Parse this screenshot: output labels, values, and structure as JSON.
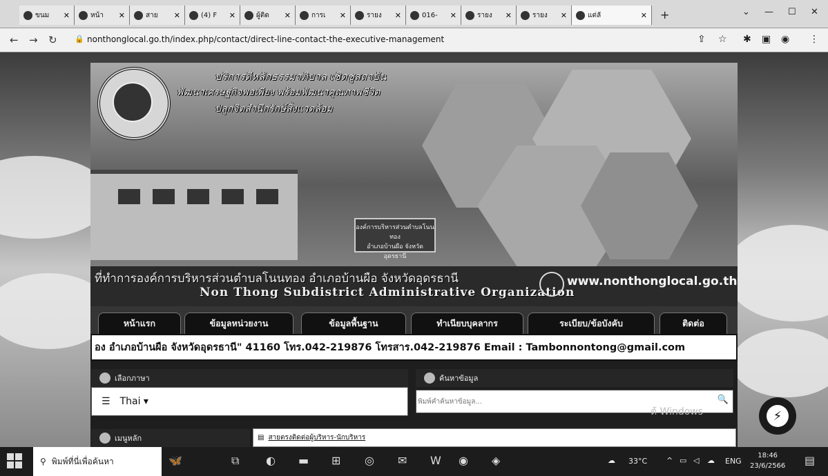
{
  "browser": {
    "tabs": [
      {
        "label": "ขนม",
        "icon": "site-icon"
      },
      {
        "label": "หน้า",
        "icon": "site-icon"
      },
      {
        "label": "สาย",
        "icon": "site-icon"
      },
      {
        "label": "(4) F",
        "icon": "facebook-icon"
      },
      {
        "label": "ผู้ติด",
        "icon": "site-icon"
      },
      {
        "label": "การเ",
        "icon": "site-icon"
      },
      {
        "label": "รายง",
        "icon": "site-icon"
      },
      {
        "label": "016-",
        "icon": "site-icon"
      },
      {
        "label": "รายง",
        "icon": "site-icon"
      },
      {
        "label": "รายง",
        "icon": "site-icon"
      },
      {
        "label": "แต่ลั",
        "icon": "site-icon"
      }
    ],
    "url": "nonthonglocal.go.th/index.php/contact/direct-line-contact-the-executive-management"
  },
  "banner": {
    "motto_line1": "บริการดีหลักธรรมาภิบาล เชิดชูสถาบัน",
    "motto_line2": "พัฒนาเศรษฐกิจพอเพียง พร้อมพัฒนาคุณภาพชีวิต",
    "motto_line3": "ปลูกจิตสำนึกรักษ์สิ่งแวดล้อม",
    "sign_line1": "องค์การบริหารส่วนตำบลโนนทอง",
    "sign_line2": "อำเภอบ้านผือ  จังหวัดอุดรธานี",
    "thai_title": "ที่ทำการองค์การบริหารส่วนตำบลโนนทอง อำเภอบ้านผือ จังหวัดอุดรธานี",
    "eng_title": "Non Thong Subdistrict Administrative Organization",
    "site_url": "www.nonthonglocal.go.th"
  },
  "menu": [
    {
      "label": "หน้าแรก"
    },
    {
      "label": "ข้อมูลหน่วยงาน"
    },
    {
      "label": "ข้อมูลพื้นฐาน"
    },
    {
      "label": "ทำเนียบบุคลากร"
    },
    {
      "label": "ระเบียบ/ข้อบังคับ"
    },
    {
      "label": "ติดต่อ"
    }
  ],
  "marquee": "อง อำเภอบ้านผือ จังหวัดอุดรธานี\" 41160 โทร.042-219876 โทรสาร.042-219876 Email : Tambonnontong@gmail.com",
  "language": {
    "header": "เลือกภาษา",
    "selected": "Thai ▾"
  },
  "search": {
    "header": "ค้นหาข้อมูล",
    "placeholder": "พิมพ์คำค้นหาข้อมูล..."
  },
  "main_menu": {
    "header": "เมนูหลัก"
  },
  "breadcrumb": {
    "label": "สายตรงติดต่อผู้บริหาร-นักบริหาร"
  },
  "watermark": "ต้ Windows",
  "taskbar": {
    "search_placeholder": "พิมพ์ที่นี่เพื่อค้นหา",
    "temperature": "33°C",
    "language": "ENG",
    "time": "18:46",
    "date": "23/6/2566"
  }
}
